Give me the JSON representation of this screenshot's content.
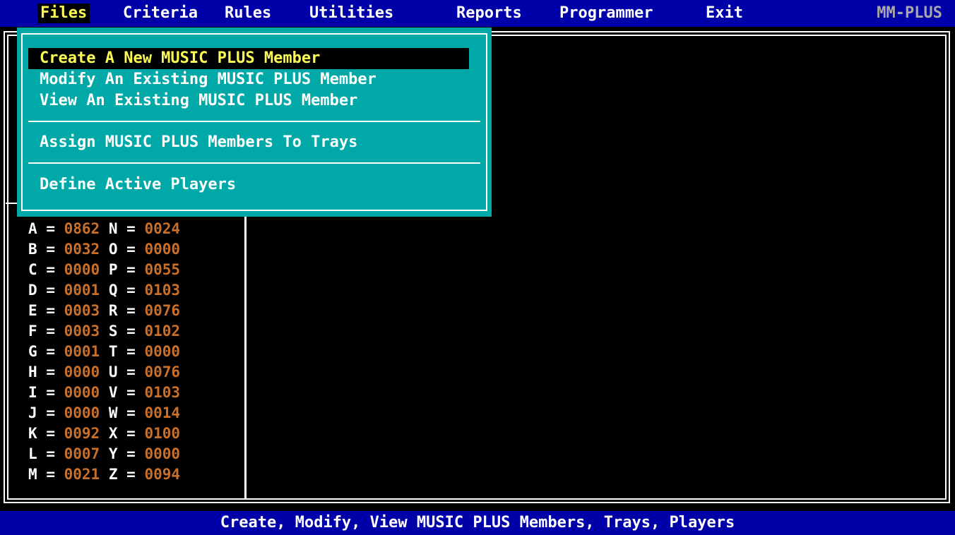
{
  "menubar": {
    "items": [
      {
        "label": "Files",
        "active": true
      },
      {
        "label": "Criteria",
        "active": false
      },
      {
        "label": "Rules",
        "active": false
      },
      {
        "label": "Utilities",
        "active": false
      },
      {
        "label": "Reports",
        "active": false
      },
      {
        "label": "Programmer",
        "active": false
      },
      {
        "label": "Exit",
        "active": false
      }
    ],
    "app_tag": "MM-PLUS"
  },
  "dropdown": {
    "items": [
      {
        "label": "Create A New MUSIC PLUS Member",
        "selected": true
      },
      {
        "label": "Modify An Existing MUSIC PLUS Member",
        "selected": false
      },
      {
        "label": "View An Existing MUSIC PLUS Member",
        "selected": false
      },
      {
        "label": "Assign MUSIC PLUS Members To Trays",
        "selected": false
      },
      {
        "label": "Define Active Players",
        "selected": false
      }
    ]
  },
  "counts": {
    "rows": [
      {
        "l1": "A",
        "v1": "0862",
        "l2": "N",
        "v2": "0024"
      },
      {
        "l1": "B",
        "v1": "0032",
        "l2": "O",
        "v2": "0000"
      },
      {
        "l1": "C",
        "v1": "0000",
        "l2": "P",
        "v2": "0055"
      },
      {
        "l1": "D",
        "v1": "0001",
        "l2": "Q",
        "v2": "0103"
      },
      {
        "l1": "E",
        "v1": "0003",
        "l2": "R",
        "v2": "0076"
      },
      {
        "l1": "F",
        "v1": "0003",
        "l2": "S",
        "v2": "0102"
      },
      {
        "l1": "G",
        "v1": "0001",
        "l2": "T",
        "v2": "0000"
      },
      {
        "l1": "H",
        "v1": "0000",
        "l2": "U",
        "v2": "0076"
      },
      {
        "l1": "I",
        "v1": "0000",
        "l2": "V",
        "v2": "0103"
      },
      {
        "l1": "J",
        "v1": "0000",
        "l2": "W",
        "v2": "0014"
      },
      {
        "l1": "K",
        "v1": "0092",
        "l2": "X",
        "v2": "0100"
      },
      {
        "l1": "L",
        "v1": "0007",
        "l2": "Y",
        "v2": "0000"
      },
      {
        "l1": "M",
        "v1": "0021",
        "l2": "Z",
        "v2": "0094"
      }
    ],
    "equals": "="
  },
  "statusbar": {
    "text": "Create, Modify, View MUSIC PLUS Members, Trays, Players"
  },
  "colors": {
    "menubar_bg": "#0000a8",
    "dropdown_bg": "#00a8a8",
    "highlight_text": "#fcfc54",
    "count_value": "#c8702a",
    "app_tag": "#a8a8a8"
  }
}
